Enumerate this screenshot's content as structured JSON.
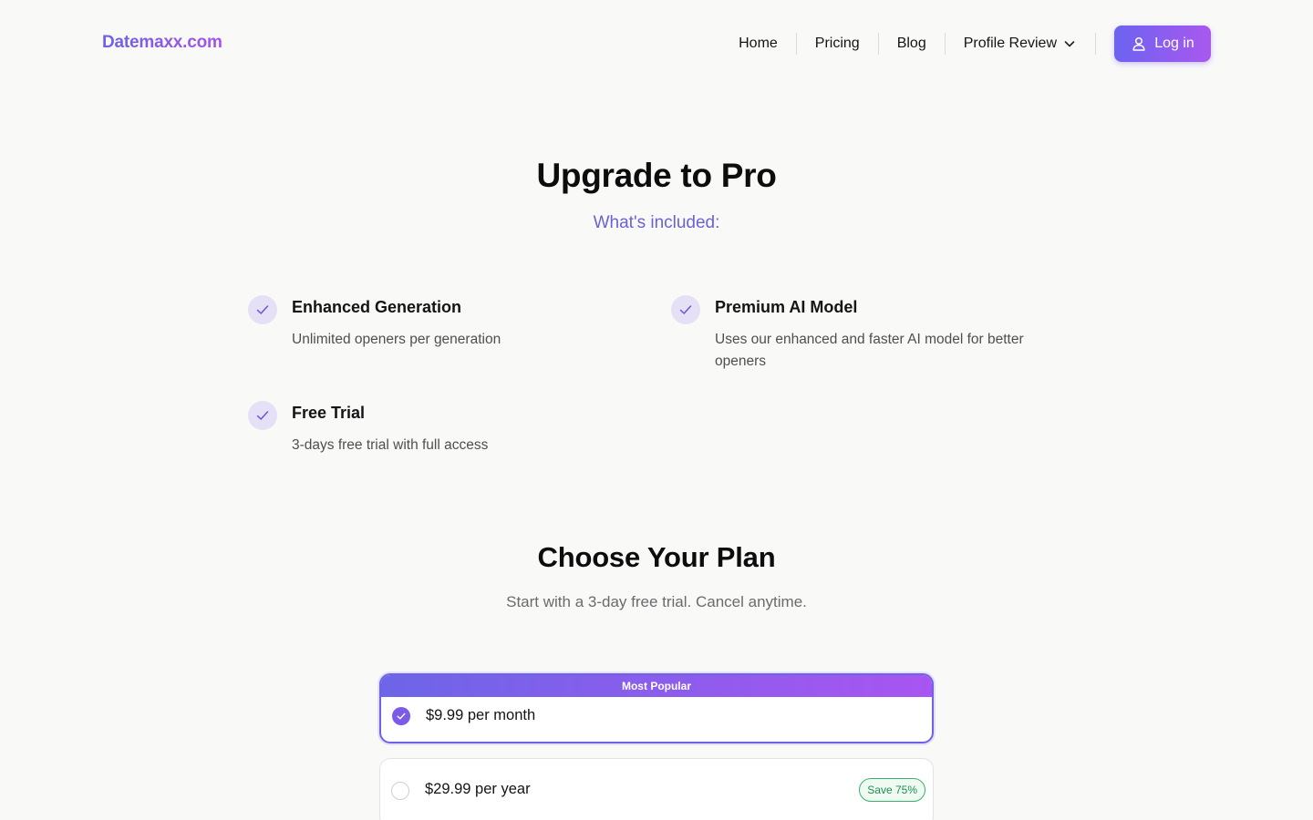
{
  "header": {
    "logo": "Datemaxx.com",
    "nav": [
      {
        "label": "Home"
      },
      {
        "label": "Pricing"
      },
      {
        "label": "Blog"
      },
      {
        "label": "Profile Review",
        "icon": "chevron-down-icon"
      }
    ],
    "login_label": "Log in",
    "login_icon": "user-icon"
  },
  "hero": {
    "title": "Upgrade to Pro",
    "subtitle": "What's included:"
  },
  "features": [
    {
      "title": "Enhanced Generation",
      "description": "Unlimited openers per generation",
      "icon": "check-icon"
    },
    {
      "title": "Premium AI Model",
      "description": "Uses our enhanced and faster AI model for better openers",
      "icon": "check-icon"
    },
    {
      "title": "Free Trial",
      "description": "3-days free trial with full access",
      "icon": "check-icon"
    }
  ],
  "plans": {
    "title": "Choose Your Plan",
    "subtitle": "Start with a 3-day free trial. Cancel anytime.",
    "options": [
      {
        "badge_top": "Most Popular",
        "price": "$9.99 per month",
        "selected": true
      },
      {
        "price": "$29.99 per year",
        "badge": "Save 75%",
        "selected": false
      }
    ]
  },
  "colors": {
    "accent_start": "#6c63e6",
    "accent_end": "#a855f1",
    "background": "#f9f9f8",
    "save_green": "#1f8f4d"
  }
}
